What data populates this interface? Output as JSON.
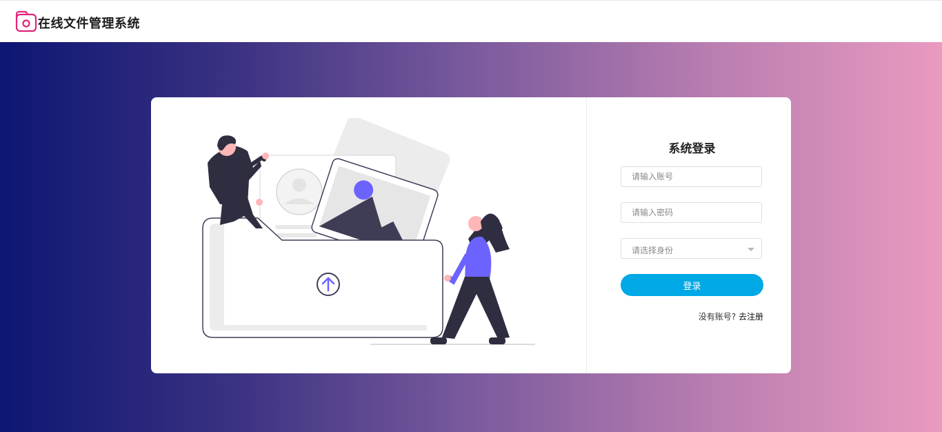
{
  "header": {
    "app_title": "在线文件管理系统",
    "logo_icon": "camera-folder-icon",
    "brand_color": "#e0247a"
  },
  "background": {
    "gradient_start": "#0d1673",
    "gradient_end": "#e99ac0"
  },
  "login": {
    "title": "系统登录",
    "account_placeholder": "请输入账号",
    "password_placeholder": "请输入密码",
    "role_placeholder": "请选择身份",
    "submit_label": "登录",
    "submit_color": "#00a8e6",
    "no_account_text": "没有账号?",
    "register_link": "去注册"
  },
  "illustration": {
    "icons": [
      "person-man-icon",
      "person-woman-icon",
      "folder-icon",
      "photo-icon",
      "upload-arrow-icon"
    ],
    "accent_color": "#6c63ff",
    "dark_color": "#2f2e41"
  }
}
